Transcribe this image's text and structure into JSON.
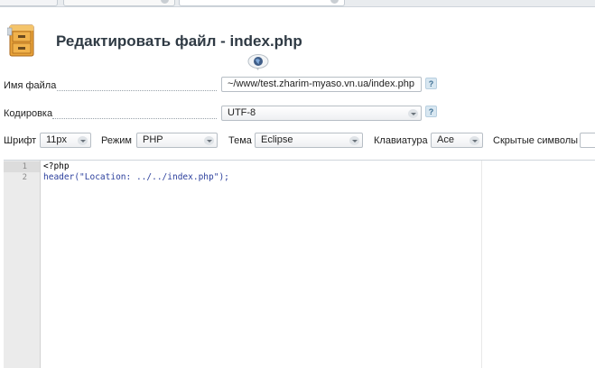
{
  "header": {
    "title": "Редактировать файл - index.php"
  },
  "form": {
    "filename_label": "Имя файла",
    "filename_value": "~/www/test.zharim-myaso.vn.ua/index.php",
    "encoding_label": "Кодировка",
    "encoding_value": "UTF-8",
    "help_glyph": "?"
  },
  "toolbar": {
    "font_label": "Шрифт",
    "font_value": "11px",
    "mode_label": "Режим",
    "mode_value": "PHP",
    "theme_label": "Тема",
    "theme_value": "Eclipse",
    "keyboard_label": "Клавиатура",
    "keyboard_value": "Ace",
    "hidden_chars_label": "Скрытые символы"
  },
  "editor": {
    "lines": [
      {
        "number": "1",
        "text": "<?php"
      },
      {
        "number": "2",
        "text": "header(\"Location: ../../index.php\");"
      }
    ]
  },
  "colors": {
    "title": "#2f3a44",
    "code_keyword": "#7f0055",
    "code_string": "#2a00ff",
    "gutter": "#ebebeb"
  },
  "icons": {
    "header": "file-cabinet-icon",
    "globe": "globe-icon",
    "dropdown": "chevron-down-icon",
    "help": "help-icon"
  }
}
